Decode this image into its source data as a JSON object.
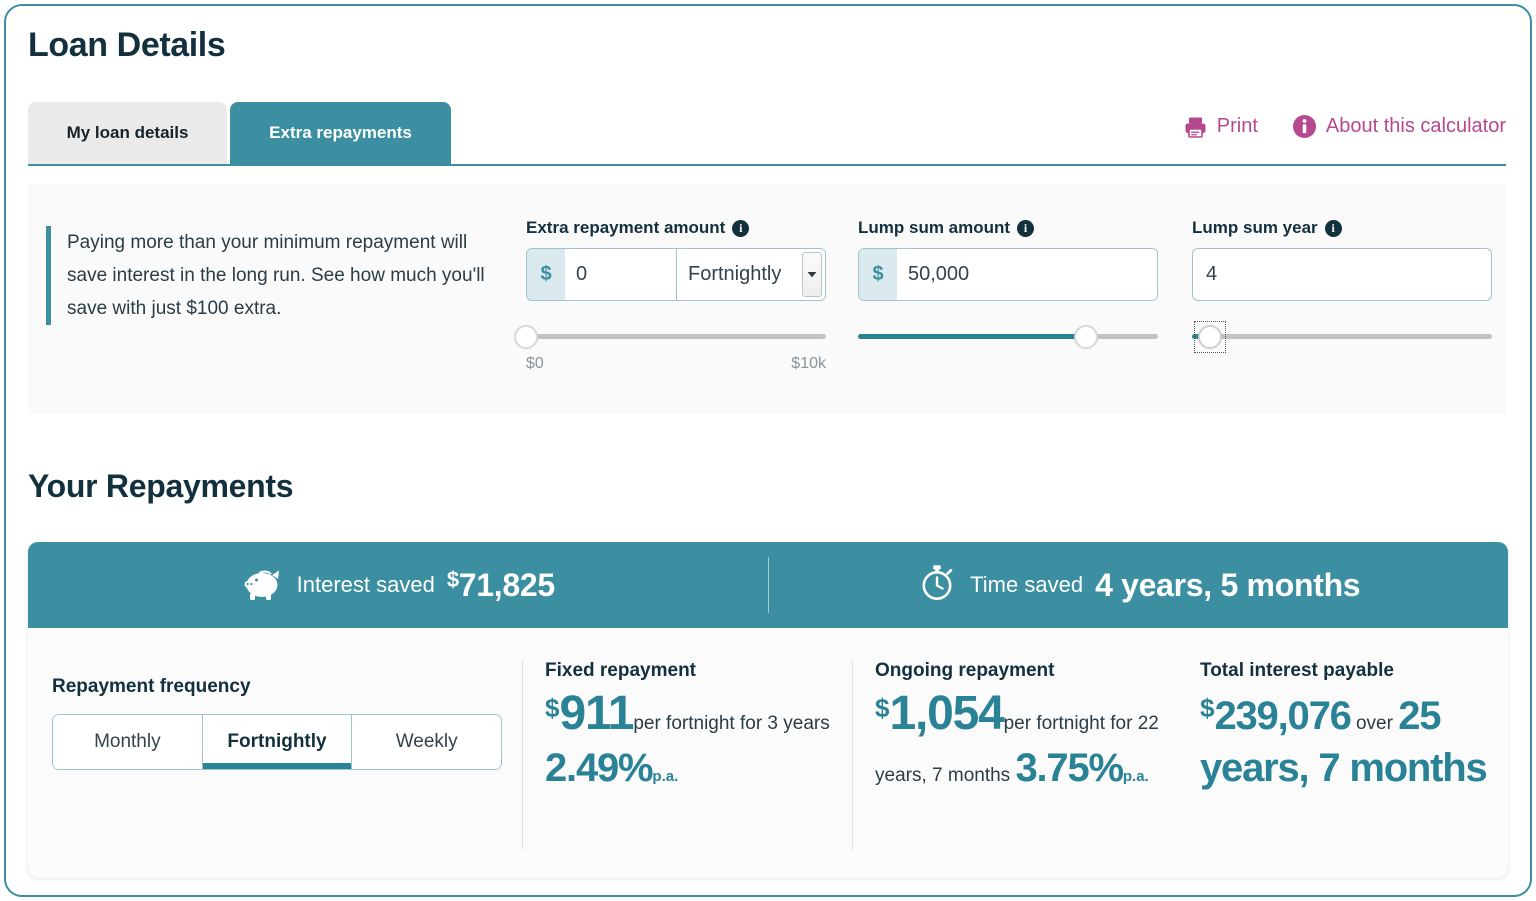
{
  "page": {
    "title": "Loan Details",
    "section_title": "Your Repayments"
  },
  "tabs": [
    {
      "label": "My loan details",
      "active": false
    },
    {
      "label": "Extra repayments",
      "active": true
    }
  ],
  "actions": {
    "print": "Print",
    "about": "About this calculator"
  },
  "blurb": "Paying more than your minimum repayment will save interest in the long run. See how much you'll save with just $100 extra.",
  "fields": {
    "extra_repayment": {
      "label": "Extra repayment amount",
      "currency_symbol": "$",
      "value": "0",
      "frequency": "Fortnightly",
      "slider": {
        "percent": 0,
        "min_label": "$0",
        "max_label": "$10k"
      }
    },
    "lump_sum_amount": {
      "label": "Lump sum amount",
      "currency_symbol": "$",
      "value": "50,000",
      "slider": {
        "percent": 76
      }
    },
    "lump_sum_year": {
      "label": "Lump sum year",
      "value": "4",
      "slider": {
        "percent": 6
      }
    }
  },
  "savings": {
    "interest": {
      "label": "Interest saved",
      "currency": "$",
      "value": "71,825"
    },
    "time": {
      "label": "Time saved",
      "value": "4 years, 5 months"
    }
  },
  "frequency": {
    "label": "Repayment frequency",
    "options": [
      "Monthly",
      "Fortnightly",
      "Weekly"
    ],
    "selected": "Fortnightly"
  },
  "results": {
    "fixed": {
      "heading": "Fixed repayment",
      "currency": "$",
      "amount": "911",
      "mid_text": "per fortnight for 3 years",
      "rate": "2.49%",
      "rate_unit": "p.a."
    },
    "ongoing": {
      "heading": "Ongoing repayment",
      "currency": "$",
      "amount": "1,054",
      "mid_text": "per fortnight for 22 years, 7 months",
      "rate": "3.75%",
      "rate_unit": "p.a."
    },
    "total_interest": {
      "heading": "Total interest payable",
      "currency": "$",
      "amount": "239,076",
      "connector": "over",
      "term": "25 years, 7 months"
    }
  },
  "colors": {
    "teal": "#3b8fa0",
    "teal_dark": "#2a8296",
    "navy": "#13303f",
    "magenta": "#b5488f"
  }
}
